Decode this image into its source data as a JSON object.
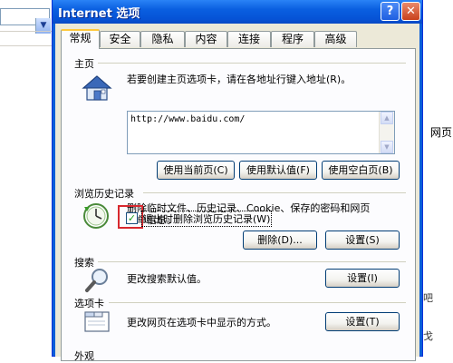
{
  "background": {
    "dropdown_glyph": "▼",
    "right_text": "网页",
    "right_small": [
      "吧",
      "戈"
    ]
  },
  "dialog": {
    "title": "Internet 选项",
    "help_glyph": "?",
    "close_glyph": "✕",
    "tabs": [
      "常规",
      "安全",
      "隐私",
      "内容",
      "连接",
      "程序",
      "高级"
    ],
    "active_tab": "常规",
    "home": {
      "section_title": "主页",
      "description": "若要创建主页选项卡，请在各地址行键入地址(R)。",
      "url": "http://www.baidu.com/",
      "btn_current": "使用当前页(C)",
      "btn_default": "使用默认值(F)",
      "btn_blank": "使用空白页(B)"
    },
    "history": {
      "section_title": "浏览历史记录",
      "description_line1": "删除临时文件、历史记录、Cookie、保存的密码和网页",
      "description_line2": "表单信息。",
      "checkbox_checked": true,
      "checkbox_glyph": "✓",
      "checkbox_label": "退出时删除浏览历史记录(W)",
      "btn_delete": "删除(D)...",
      "btn_settings": "设置(S)"
    },
    "search": {
      "section_title": "搜索",
      "description": "更改搜索默认值。",
      "btn_settings": "设置(I)"
    },
    "tabs_section": {
      "section_title": "选项卡",
      "description": "更改网页在选项卡中显示的方式。",
      "btn_settings": "设置(T)"
    },
    "appearance": {
      "section_title": "外观"
    }
  },
  "colors": {
    "title_bar": "#0a5fe0",
    "dialog_face": "#ece9d8",
    "tab_highlight": "#ffc83c",
    "annotation_red": "#d8282f"
  },
  "icons": [
    "house-icon",
    "history-clock-icon",
    "magnifier-icon",
    "tabs-window-icon"
  ]
}
